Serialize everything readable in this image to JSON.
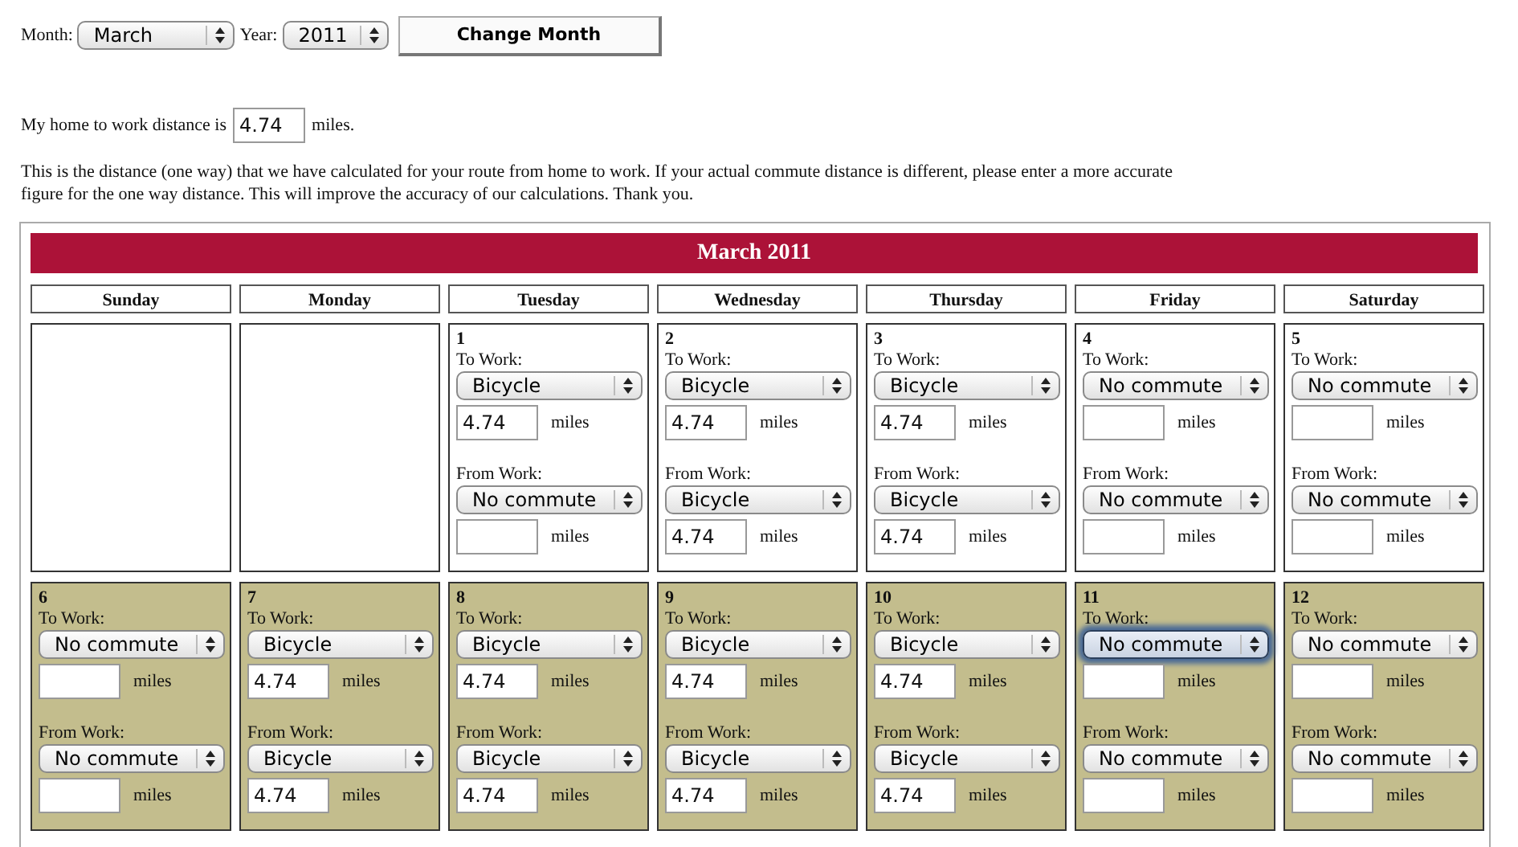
{
  "controls": {
    "month_label": "Month:",
    "month": "March",
    "year_label": "Year:",
    "year": "2011",
    "button": "Change Month"
  },
  "distance": {
    "label": "My home to work distance is",
    "value": "4.74",
    "unit": "miles."
  },
  "note": "This is the distance (one way) that we have calculated for your route from home to work. If your actual commute distance is different, please enter a more accurate figure for the one way distance. This will improve the accuracy of our calculations. Thank you.",
  "calendar": {
    "title": "March 2011",
    "weekdays": [
      "Sunday",
      "Monday",
      "Tuesday",
      "Wednesday",
      "Thursday",
      "Friday",
      "Saturday"
    ],
    "weeks": [
      [
        {
          "kind": "empty"
        },
        {
          "kind": "empty"
        },
        {
          "kind": "day",
          "day": "1",
          "shaded": false,
          "to_work": {
            "label": "To Work:",
            "mode": "Bicycle",
            "focused": false,
            "miles": "4.74",
            "unit": "miles"
          },
          "from_work": {
            "label": "From Work:",
            "mode": "No commute",
            "focused": false,
            "unit": "miles"
          }
        },
        {
          "kind": "day",
          "day": "2",
          "shaded": false,
          "to_work": {
            "label": "To Work:",
            "mode": "Bicycle",
            "focused": false,
            "miles": "4.74",
            "unit": "miles"
          },
          "from_work": {
            "label": "From Work:",
            "mode": "Bicycle",
            "focused": false,
            "miles": "4.74",
            "unit": "miles"
          }
        },
        {
          "kind": "day",
          "day": "3",
          "shaded": false,
          "to_work": {
            "label": "To Work:",
            "mode": "Bicycle",
            "focused": false,
            "miles": "4.74",
            "unit": "miles"
          },
          "from_work": {
            "label": "From Work:",
            "mode": "Bicycle",
            "focused": false,
            "miles": "4.74",
            "unit": "miles"
          }
        },
        {
          "kind": "day",
          "day": "4",
          "shaded": false,
          "to_work": {
            "label": "To Work:",
            "mode": "No commute",
            "focused": false,
            "unit": "miles"
          },
          "from_work": {
            "label": "From Work:",
            "mode": "No commute",
            "focused": false,
            "unit": "miles"
          }
        },
        {
          "kind": "day",
          "day": "5",
          "shaded": false,
          "to_work": {
            "label": "To Work:",
            "mode": "No commute",
            "focused": false,
            "unit": "miles"
          },
          "from_work": {
            "label": "From Work:",
            "mode": "No commute",
            "focused": false,
            "unit": "miles"
          }
        }
      ],
      [
        {
          "kind": "day",
          "day": "6",
          "shaded": true,
          "to_work": {
            "label": "To Work:",
            "mode": "No commute",
            "focused": false,
            "unit": "miles"
          },
          "from_work": {
            "label": "From Work:",
            "mode": "No commute",
            "focused": false,
            "unit": "miles"
          }
        },
        {
          "kind": "day",
          "day": "7",
          "shaded": true,
          "to_work": {
            "label": "To Work:",
            "mode": "Bicycle",
            "focused": false,
            "miles": "4.74",
            "unit": "miles"
          },
          "from_work": {
            "label": "From Work:",
            "mode": "Bicycle",
            "focused": false,
            "miles": "4.74",
            "unit": "miles"
          }
        },
        {
          "kind": "day",
          "day": "8",
          "shaded": true,
          "to_work": {
            "label": "To Work:",
            "mode": "Bicycle",
            "focused": false,
            "miles": "4.74",
            "unit": "miles"
          },
          "from_work": {
            "label": "From Work:",
            "mode": "Bicycle",
            "focused": false,
            "miles": "4.74",
            "unit": "miles"
          }
        },
        {
          "kind": "day",
          "day": "9",
          "shaded": true,
          "to_work": {
            "label": "To Work:",
            "mode": "Bicycle",
            "focused": false,
            "miles": "4.74",
            "unit": "miles"
          },
          "from_work": {
            "label": "From Work:",
            "mode": "Bicycle",
            "focused": false,
            "miles": "4.74",
            "unit": "miles"
          }
        },
        {
          "kind": "day",
          "day": "10",
          "shaded": true,
          "to_work": {
            "label": "To Work:",
            "mode": "Bicycle",
            "focused": false,
            "miles": "4.74",
            "unit": "miles"
          },
          "from_work": {
            "label": "From Work:",
            "mode": "Bicycle",
            "focused": false,
            "miles": "4.74",
            "unit": "miles"
          }
        },
        {
          "kind": "day",
          "day": "11",
          "shaded": true,
          "to_work": {
            "label": "To Work:",
            "mode": "No commute",
            "focused": true,
            "unit": "miles"
          },
          "from_work": {
            "label": "From Work:",
            "mode": "No commute",
            "focused": false,
            "unit": "miles"
          }
        },
        {
          "kind": "day",
          "day": "12",
          "shaded": true,
          "to_work": {
            "label": "To Work:",
            "mode": "No commute",
            "focused": false,
            "unit": "miles"
          },
          "from_work": {
            "label": "From Work:",
            "mode": "No commute",
            "focused": false,
            "unit": "miles"
          }
        }
      ]
    ]
  }
}
